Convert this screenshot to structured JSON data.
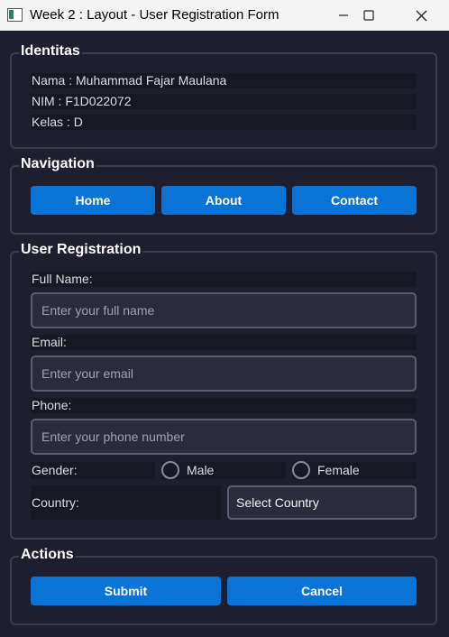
{
  "window": {
    "title": "Week 2 : Layout - User Registration Form"
  },
  "identitas": {
    "title": "Identitas",
    "nama": "Nama : Muhammad Fajar Maulana",
    "nim": "NIM : F1D022072",
    "kelas": "Kelas : D"
  },
  "navigation": {
    "title": "Navigation",
    "home": "Home",
    "about": "About",
    "contact": "Contact"
  },
  "registration": {
    "title": "User Registration",
    "full_name_label": "Full Name:",
    "full_name_placeholder": "Enter your full name",
    "email_label": "Email:",
    "email_placeholder": "Enter your email",
    "phone_label": "Phone:",
    "phone_placeholder": "Enter your phone number",
    "gender_label": "Gender:",
    "male_label": "Male",
    "female_label": "Female",
    "country_label": "Country:",
    "country_value": "Select Country"
  },
  "actions": {
    "title": "Actions",
    "submit": "Submit",
    "cancel": "Cancel"
  },
  "colors": {
    "background": "#1e1e2e",
    "accent": "#0a74d6",
    "border": "#3b3c50"
  }
}
